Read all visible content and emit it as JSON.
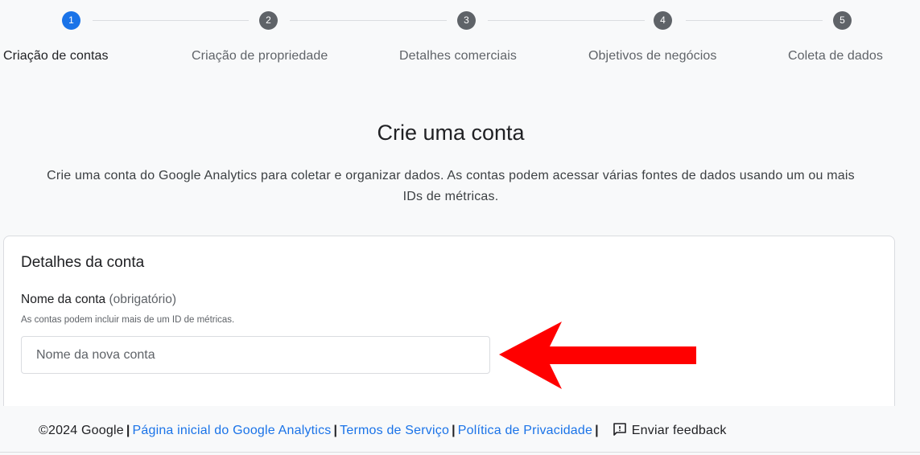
{
  "stepper": {
    "steps": [
      {
        "number": "1",
        "label": "Criação de contas",
        "active": true
      },
      {
        "number": "2",
        "label": "Criação de propriedade",
        "active": false
      },
      {
        "number": "3",
        "label": "Detalhes comerciais",
        "active": false
      },
      {
        "number": "4",
        "label": "Objetivos de negócios",
        "active": false
      },
      {
        "number": "5",
        "label": "Coleta de dados",
        "active": false
      }
    ]
  },
  "page": {
    "title": "Crie uma conta",
    "subtitle": "Crie uma conta do Google Analytics para coletar e organizar dados. As contas podem acessar várias fontes de dados usando um ou mais IDs de métricas."
  },
  "card": {
    "title": "Detalhes da conta",
    "field_label": "Nome da conta",
    "field_required": "(obrigatório)",
    "field_help": "As contas podem incluir mais de um ID de métricas.",
    "input_placeholder": "Nome da nova conta",
    "input_value": ""
  },
  "annotation": {
    "arrow_color": "#ff0000"
  },
  "footer": {
    "copyright": "©2024 Google",
    "link_home": "Página inicial do Google Analytics",
    "link_terms": "Termos de Serviço",
    "link_privacy": "Política de Privacidade",
    "feedback": "Enviar feedback"
  },
  "colors": {
    "accent": "#1a73e8",
    "inactive_step": "#5f6368"
  }
}
